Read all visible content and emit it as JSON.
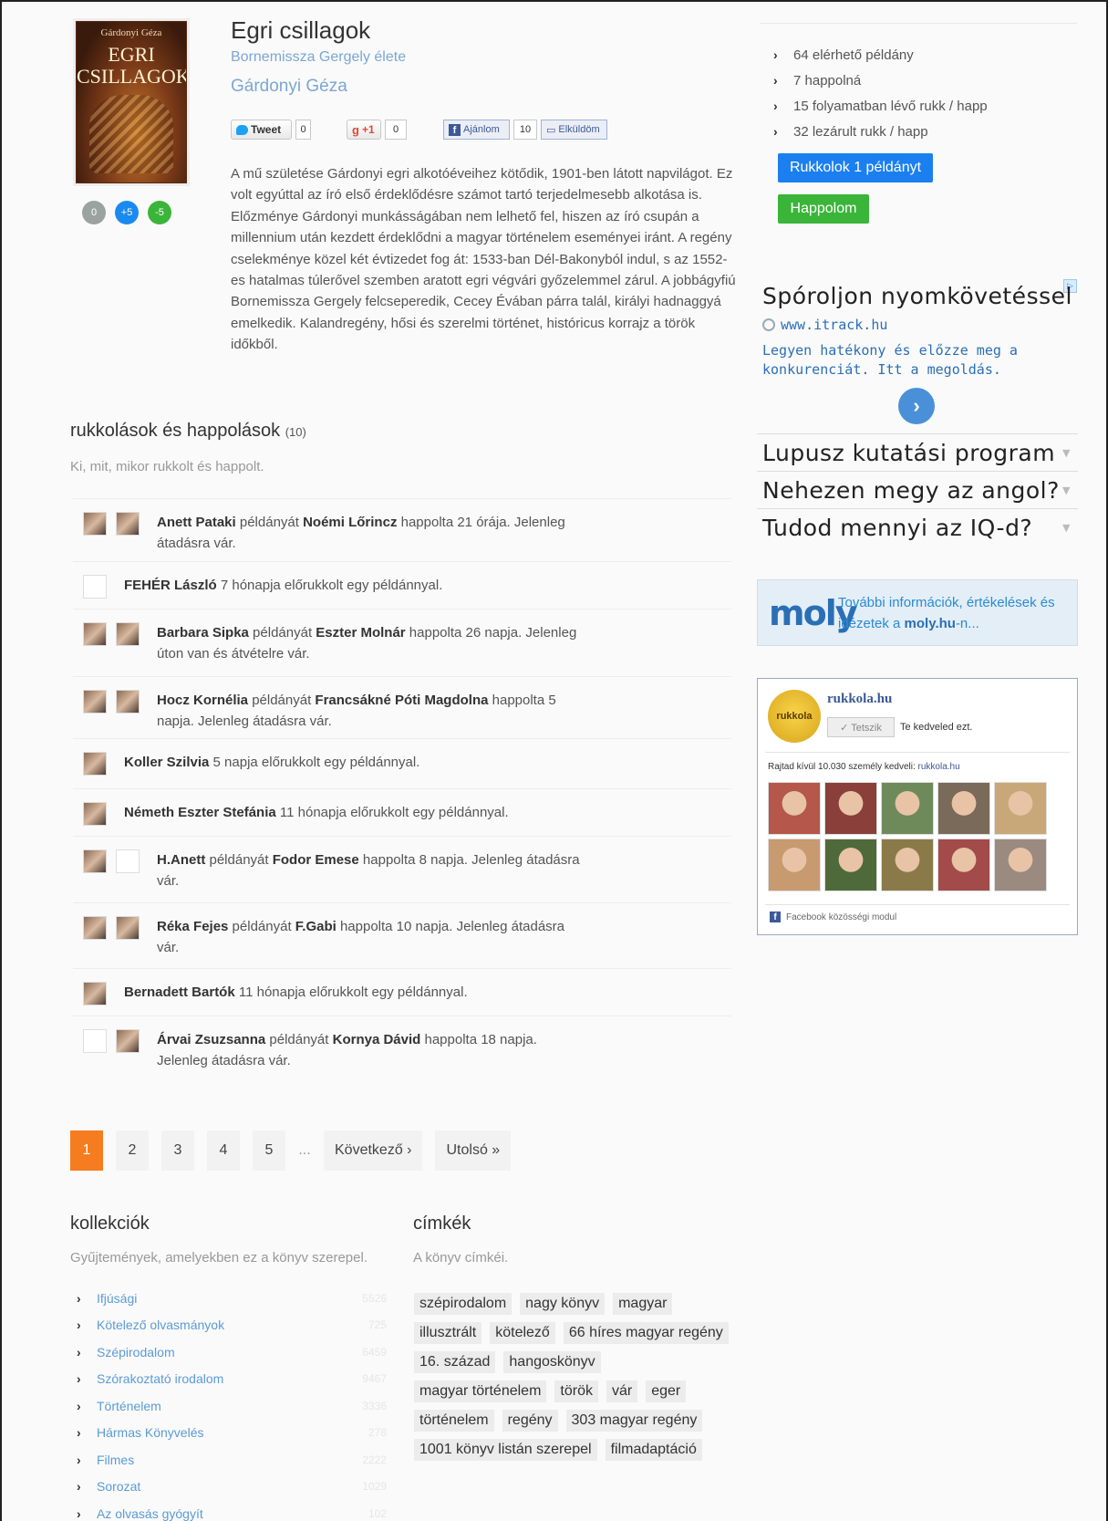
{
  "book": {
    "title": "Egri csillagok",
    "subtitle": "Bornemissza Gergely élete",
    "author": "Gárdonyi Géza",
    "cover": {
      "author": "Gárdonyi Géza",
      "title_line1": "EGRI",
      "title_line2": "CSILLAGOK"
    },
    "rating": {
      "neutral": "0",
      "plus": "+5",
      "minus": "-5"
    },
    "description": "A mű születése Gárdonyi egri alkotóéveihez kötődik, 1901-ben látott napvilágot. Ez volt egyúttal az író első érdeklődésre számot tartó terjedelmesebb alkotása is. Előzménye Gárdonyi munkásságában nem lelhető fel, hiszen az író csupán a millennium után kezdett érdeklődni a magyar történelem eseményei iránt. A regény cselekménye közel két évtizedet fog át: 1533-ban Dél-Bakonyból indul, s az 1552-es hatalmas túlerővel szemben aratott egri végvári győzelemmel zárul. A jobbágyfiú Bornemissza Gergely felcseperedik, Cecey Évában párra talál, királyi hadnaggyá emelkedik. Kalandregény, hősi és szerelmi történet, históricus korrajz a török időkből."
  },
  "social": {
    "tweet_label": "Tweet",
    "tweet_count": "0",
    "gplus_label": "+1",
    "gplus_count": "0",
    "fb_recommend_label": "Ajánlom",
    "fb_count": "10",
    "fb_send_label": "Elküldöm"
  },
  "stats": [
    "64 elérhető példány",
    "7 happolná",
    "15 folyamatban lévő rukk / happ",
    "32 lezárult rukk / happ"
  ],
  "actions": {
    "rukk_button": "Rukkolok 1 példányt",
    "happ_button": "Happolom"
  },
  "ad": {
    "badge": "▷",
    "title": "Spóroljon nyomkövetéssel",
    "url": "www.itrack.hu",
    "text": "Legyen hatékony és előzze meg a konkurenciát. Itt a megoldás.",
    "arrow": "›",
    "links": [
      "Lupusz kutatási program",
      "Nehezen megy az angol?",
      "Tudod mennyi az IQ-d?"
    ]
  },
  "moly": {
    "logo": "moly",
    "text_before": "További információk, értékelések és idézetek a ",
    "text_link": "moly.hu",
    "text_after": "-n..."
  },
  "facebook": {
    "logo_text": "rukkola",
    "page_name": "rukkola.hu",
    "like_button": "✓ Tetszik",
    "likes_you": "Te kedveled ezt.",
    "count_text": "Rajtad kívül 10.030 személy kedveli: ",
    "count_link": "rukkola.hu",
    "footer": "Facebook közösségi modul",
    "face_colors": [
      "#b5574a",
      "#8a3f3a",
      "#6f8a5a",
      "#7a6a5a",
      "#c8a878",
      "#c79a70",
      "#4f6a3a",
      "#8a7a4a",
      "#a34a4a",
      "#9a8a80"
    ]
  },
  "activity": {
    "title": "rukkolások és happolások",
    "count": "(10)",
    "subtitle": "Ki, mit, mikor rukkolt és happolt.",
    "items": [
      {
        "type": "happ",
        "owner": "Anett Pataki",
        "mid1": " példányát ",
        "taker": "Noémi Lőrincz",
        "rest": " happolta 21 órája. Jelenleg átadásra vár."
      },
      {
        "type": "rukk",
        "owner": "FEHÉR László",
        "rest": " 7 hónapja előrukkolt egy példánnyal."
      },
      {
        "type": "happ",
        "owner": "Barbara Sipka",
        "mid1": " példányát ",
        "taker": "Eszter Molnár",
        "rest": " happolta 26 napja. Jelenleg úton van és átvételre vár."
      },
      {
        "type": "happ",
        "owner": "Hocz Kornélia",
        "mid1": " példányát ",
        "taker": "Francsákné Póti Magdolna",
        "rest": " happolta 5 napja. Jelenleg átadásra vár."
      },
      {
        "type": "rukk",
        "owner": "Koller Szilvia",
        "rest": " 5 napja előrukkolt egy példánnyal."
      },
      {
        "type": "rukk",
        "owner": "Németh Eszter Stefánia",
        "rest": " 11 hónapja előrukkolt egy példánnyal."
      },
      {
        "type": "happ",
        "owner": "H.Anett",
        "mid1": " példányát ",
        "taker": "Fodor Emese",
        "rest": " happolta 8 napja. Jelenleg átadásra vár."
      },
      {
        "type": "happ",
        "owner": "Réka Fejes",
        "mid1": " példányát ",
        "taker": "F.Gabi",
        "rest": " happolta 10 napja. Jelenleg átadásra vár."
      },
      {
        "type": "rukk",
        "owner": "Bernadett Bartók",
        "rest": " 11 hónapja előrukkolt egy példánnyal."
      },
      {
        "type": "happ",
        "owner": "Árvai Zsuzsanna",
        "mid1": " példányát ",
        "taker": "Kornya Dávid",
        "rest": " happolta 18 napja. Jelenleg átadásra vár."
      }
    ]
  },
  "pagination": {
    "pages": [
      "1",
      "2",
      "3",
      "4",
      "5"
    ],
    "current": "1",
    "dots": "...",
    "next": "Következő ›",
    "last": "Utolsó »"
  },
  "collections": {
    "title": "kollekciók",
    "subtitle": "Gyűjtemények, amelyekben ez a könyv szerepel.",
    "items": [
      {
        "name": "Ifjúsági",
        "count": "5526"
      },
      {
        "name": "Kötelező olvasmányok",
        "count": "725"
      },
      {
        "name": "Szépirodalom",
        "count": "6459"
      },
      {
        "name": "Szórakoztató irodalom",
        "count": "9467"
      },
      {
        "name": "Történelem",
        "count": "3336"
      },
      {
        "name": "Hármas Könyvelés",
        "count": "278"
      },
      {
        "name": "Filmes",
        "count": "2222"
      },
      {
        "name": "Sorozat",
        "count": "1029"
      },
      {
        "name": "Az olvasás gyógyít",
        "count": "102"
      }
    ]
  },
  "tags": {
    "title": "címkék",
    "subtitle": "A könyv címkéi.",
    "items": [
      "szépirodalom",
      "nagy könyv",
      "magyar",
      "illusztrált",
      "kötelező",
      "66 híres magyar regény",
      "16. század",
      "hangoskönyv",
      "magyar történelem",
      "török",
      "vár",
      "eger",
      "történelem",
      "regény",
      "303 magyar regény",
      "1001 könyv listán szerepel",
      "filmadaptáció"
    ]
  }
}
